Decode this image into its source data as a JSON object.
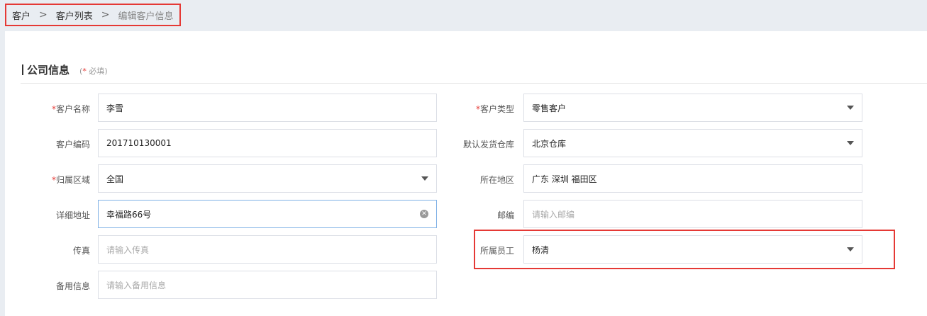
{
  "breadcrumb": {
    "items": [
      "客户",
      "客户列表",
      "编辑客户信息"
    ],
    "separator": ">"
  },
  "section": {
    "title": "公司信息",
    "required_star": "*",
    "required_text": " 必填"
  },
  "form": {
    "left": {
      "customer_name": {
        "label": "客户名称",
        "required": true,
        "value": "李雪"
      },
      "customer_code": {
        "label": "客户编码",
        "value": "201710130001"
      },
      "region": {
        "label": "归属区域",
        "required": true,
        "value": "全国"
      },
      "address": {
        "label": "详细地址",
        "value": "幸福路66号"
      },
      "fax": {
        "label": "传真",
        "placeholder": "请输入传真"
      },
      "remark": {
        "label": "备用信息",
        "placeholder": "请输入备用信息"
      }
    },
    "right": {
      "customer_type": {
        "label": "客户类型",
        "required": true,
        "value": "零售客户"
      },
      "warehouse": {
        "label": "默认发货仓库",
        "value": "北京仓库"
      },
      "location": {
        "label": "所在地区",
        "value": "广东 深圳 福田区"
      },
      "postcode": {
        "label": "邮编",
        "placeholder": "请输入邮编"
      },
      "employee": {
        "label": "所属员工",
        "value": "杨清"
      }
    }
  },
  "icons": {
    "dropdown": "caret-down-icon",
    "clear": "clear-icon"
  },
  "colors": {
    "highlight": "#e53935",
    "required_star": "#e53935",
    "background": "#e9edf2",
    "focus_border": "#7fb1e6"
  }
}
